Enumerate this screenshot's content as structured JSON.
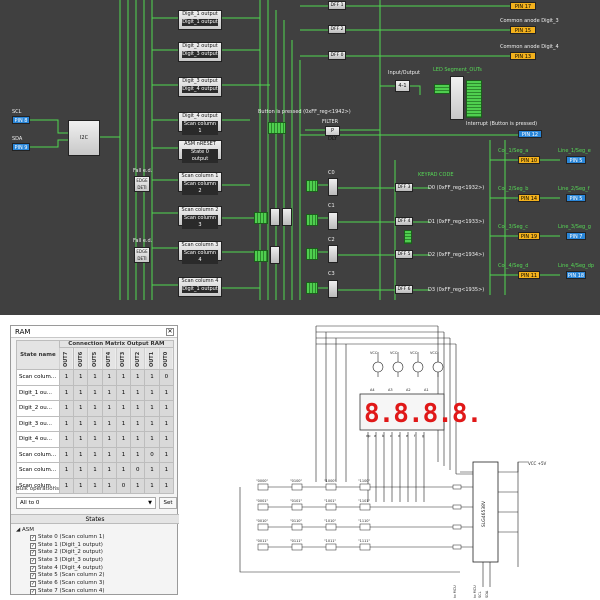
{
  "schematic": {
    "left_inputs": [
      {
        "pin_label": "SCL",
        "pin_name": "PIN 8"
      },
      {
        "pin_label": "SDA",
        "pin_name": "PIN 9"
      }
    ],
    "i2c_label": "I2C",
    "lut_blocks": [
      {
        "label": "",
        "sub": "Digit_1 output"
      },
      {
        "label": "Digit_2 output",
        "sub": "Digit_1 output"
      },
      {
        "label": "Digit_2 output",
        "sub": "Digit_3 output"
      },
      {
        "label": "Digit_3 output",
        "sub": "Digit_4 output"
      },
      {
        "label": "Digit_4 output",
        "sub": "Scan column 1"
      },
      {
        "label": "ASM nRESET",
        "sub": "State 0 output"
      },
      {
        "label": "Scan column 1",
        "sub": "Scan column 2"
      },
      {
        "label": "Scan column 2",
        "sub": "Scan column 3"
      },
      {
        "label": "Scan column 3",
        "sub": "Scan column 4"
      },
      {
        "label": "Scan column 4",
        "sub": "Digit_1 output"
      }
    ],
    "dffs": [
      "DFF 1",
      "DFF 2",
      "DFF 0"
    ],
    "right_pins_top": [
      {
        "label": "",
        "pin": "PIN 17"
      },
      {
        "label": "Common anode Digit_3",
        "pin": "PIN 15"
      },
      {
        "label": "Common anode Digit_4",
        "pin": "PIN 13"
      }
    ],
    "io_label": "Input/Output",
    "io_chip": "4-1",
    "led_label": "LED Segment_OUTs",
    "button_label": "Button is pressed\n(0xFF_reg<1942>)",
    "filter_label": "FILTER",
    "filter_block": "P DLY",
    "interrupt_label": "Interrupt (Button is pressed)",
    "interrupt_pin": "PIN 12",
    "edge_label": "Fall e.d.",
    "edge_block": "EDGE DETI",
    "keypad_label": "KEYPAD CODE",
    "d_labels": [
      "C0",
      "C1",
      "C2",
      "C3"
    ],
    "dff_out": [
      {
        "dff": "DFF 3",
        "text": "D0 (0xFF_reg<1932>)"
      },
      {
        "dff": "DFF 4",
        "text": "D1 (0xFF_reg<1933>)"
      },
      {
        "dff": "DFF 5",
        "text": "D2 (0xFF_reg<1934>)"
      },
      {
        "dff": "DFF 6",
        "text": "D3 (0xFF_reg<1935>)"
      }
    ],
    "col_pins": [
      {
        "left": "Col_1/Seg_a",
        "lpin": "PIN 10",
        "right": "Line_1/Seg_e",
        "rpin": "PIN 5"
      },
      {
        "left": "Col_2/Seg_b",
        "lpin": "PIN 14",
        "right": "Line_2/Seg_f",
        "rpin": "PIN 5"
      },
      {
        "left": "Col_3/Seg_c",
        "lpin": "PIN 19",
        "right": "Line_3/Seg_g",
        "rpin": "PIN 7"
      },
      {
        "left": "Col_4/Seg_d",
        "lpin": "PIN 11",
        "right": "Line_4/Seg_dp",
        "rpin": "PIN 18"
      }
    ]
  },
  "ram": {
    "title": "RAM",
    "close_icon": "close-icon",
    "header_group": "Connection Matrix Output RAM",
    "state_name_header": "State name",
    "columns": [
      "OUT7",
      "OUT6",
      "OUT5",
      "OUT4",
      "OUT3",
      "OUT2",
      "OUT1",
      "OUT0"
    ],
    "rows": [
      {
        "name": "Scan colum...",
        "bits": [
          "1",
          "1",
          "1",
          "1",
          "1",
          "1",
          "1",
          "0"
        ]
      },
      {
        "name": "Digit_1 ou...",
        "bits": [
          "1",
          "1",
          "1",
          "1",
          "1",
          "1",
          "1",
          "1"
        ]
      },
      {
        "name": "Digit_2 ou...",
        "bits": [
          "1",
          "1",
          "1",
          "1",
          "1",
          "1",
          "1",
          "1"
        ]
      },
      {
        "name": "Digit_3 ou...",
        "bits": [
          "1",
          "1",
          "1",
          "1",
          "1",
          "1",
          "1",
          "1"
        ]
      },
      {
        "name": "Digit_4 ou...",
        "bits": [
          "1",
          "1",
          "1",
          "1",
          "1",
          "1",
          "1",
          "1"
        ]
      },
      {
        "name": "Scan colum...",
        "bits": [
          "1",
          "1",
          "1",
          "1",
          "1",
          "1",
          "0",
          "1"
        ]
      },
      {
        "name": "Scan colum...",
        "bits": [
          "1",
          "1",
          "1",
          "1",
          "1",
          "0",
          "1",
          "1"
        ]
      },
      {
        "name": "Scan colum...",
        "bits": [
          "1",
          "1",
          "1",
          "1",
          "0",
          "1",
          "1",
          "1"
        ]
      }
    ],
    "bulk_label": "Bulk operations",
    "bulk_value": "All to 0",
    "set_label": "Set",
    "states_header": "States",
    "asm_label": "ASM",
    "states": [
      "State 0 (Scan column 1)",
      "State 1 (Digit_1 output)",
      "State 2 (Digit_2 output)",
      "State 3 (Digit_3 output)",
      "State 4 (Digit_4 output)",
      "State 5 (Scan column 2)",
      "State 6 (Scan column 3)",
      "State 7 (Scan column 4)"
    ]
  },
  "circuit": {
    "vcc": "VCC",
    "vcc_main": "VCC +5V",
    "digit_labels": [
      "A4",
      "A3",
      "A2",
      "A1"
    ],
    "display_text": "8.8.8.8.",
    "segment_labels": [
      "dp",
      "a",
      "b",
      "c",
      "d",
      "e",
      "f",
      "g"
    ],
    "ic_label": "SLG46538V",
    "key_labels": [
      [
        "\"0000\"",
        "\"0100\"",
        "\"1000\"",
        "\"1100\""
      ],
      [
        "\"0001\"",
        "\"0101\"",
        "\"1001\"",
        "\"1101\""
      ],
      [
        "\"0010\"",
        "\"0110\"",
        "\"1010\"",
        "\"1110\""
      ],
      [
        "\"0011\"",
        "\"0111\"",
        "\"1011\"",
        "\"1111\""
      ]
    ],
    "bottom_labels": [
      "SCL",
      "SDA",
      "to MCU",
      "to MCU"
    ]
  },
  "colors": {
    "schematic_bg": "#404040",
    "wire": "#4fd84f",
    "pin_yellow": "#f3b11c",
    "pin_blue": "#2a86d8",
    "led_red": "#e01818"
  }
}
